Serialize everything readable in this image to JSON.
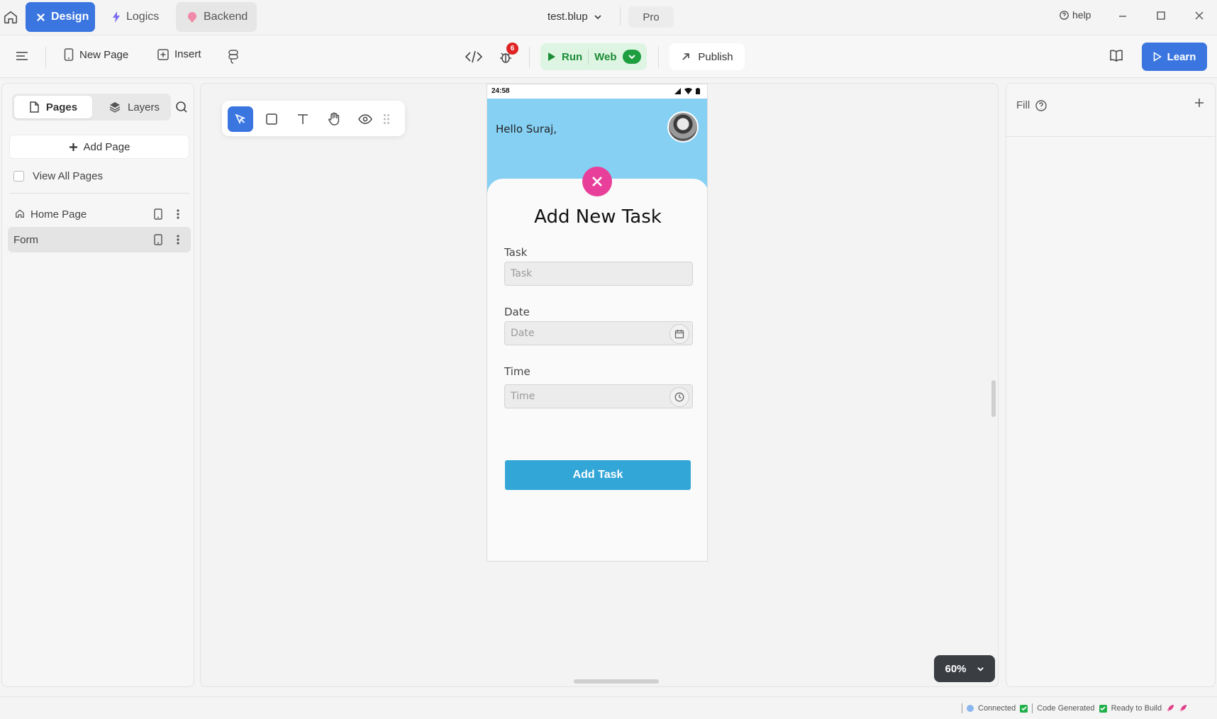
{
  "titlebar": {
    "tabs": [
      {
        "label": "Design"
      },
      {
        "label": "Logics"
      },
      {
        "label": "Backend"
      }
    ],
    "file_name": "test.blup",
    "plan": "Pro",
    "help": "help"
  },
  "toolbar": {
    "new_page": "New Page",
    "insert": "Insert",
    "bug_count": "6",
    "run": "Run",
    "target": "Web",
    "publish": "Publish",
    "learn": "Learn"
  },
  "left_panel": {
    "tabs": {
      "pages": "Pages",
      "layers": "Layers"
    },
    "add_page": "Add Page",
    "view_all": "View All Pages",
    "pages": [
      {
        "label": "Home Page"
      },
      {
        "label": "Form"
      }
    ]
  },
  "canvas": {
    "zoom": "60%"
  },
  "phone": {
    "time": "24:58",
    "greeting": "Hello Suraj,",
    "title": "Add New Task",
    "fields": [
      {
        "label": "Task",
        "placeholder": "Task"
      },
      {
        "label": "Date",
        "placeholder": "Date"
      },
      {
        "label": "Time",
        "placeholder": "Time"
      }
    ],
    "submit": "Add Task"
  },
  "right_panel": {
    "fill": "Fill"
  },
  "status": {
    "connected": "Connected",
    "code": "Code Generated",
    "ready": "Ready to Build"
  }
}
